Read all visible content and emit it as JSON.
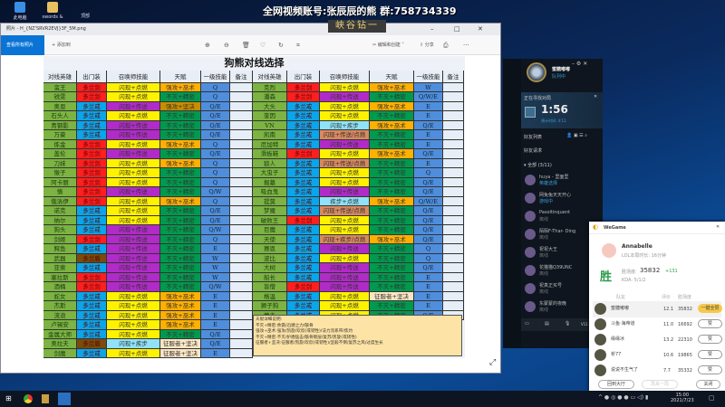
{
  "desktop": {
    "icons": [
      "此电脑",
      "swords &",
      "顶部"
    ]
  },
  "overlay": {
    "banner": "全网视频账号:张辰辰的熊  群:758734339",
    "tag": "峡谷钻一"
  },
  "photos": {
    "title": "照片 - H_{NZ'SRVR2EVJ}3F_5M.png",
    "view_all": "查看所有照片",
    "add_to": "+ 添加到",
    "edit_create": "编辑和创建",
    "share": "分享",
    "sheet": {
      "title": "狗熊对线选择",
      "headers": [
        "对线英雄",
        "出门装",
        "召唤师技能",
        "天赋",
        "一级技能",
        "备注"
      ],
      "colors": {
        "hero": "#7cb342",
        "多兰剑": "#ff1f1f",
        "多兰戒": "#0aa5ea",
        "多兰盾": "#7a4b0a",
        "闪现+点燃": "#fff200",
        "闪现+传送": "#b12bc8",
        "闪现+疾步": "#8fe2f7",
        "疾步+点燃": "#8fe2f7",
        "闪现+传送/点燃": "#d9895e",
        "闪现+疾步/点燃": "#d9895e",
        "强攻+巫术": "#ffb000",
        "不灭+精密": "#009a4e",
        "强攻+坚决": "#c88d00",
        "征服者+坚决": "#fbe6c4",
        "skill": "#4f8edc",
        "note": "#e6eef8"
      },
      "left": [
        [
          "蛮王",
          "多兰剑",
          "闪现+点燃",
          "强攻+巫术",
          "Q"
        ],
        [
          "锐雯",
          "多兰剑",
          "闪现+点燃",
          "不灭+精密",
          "Q"
        ],
        [
          "奥恩",
          "多兰戒",
          "闪现+传送",
          "强攻+坚决",
          "Q/E"
        ],
        [
          "石头人",
          "多兰戒",
          "闪现+点燃",
          "不灭+精密",
          "Q/E"
        ],
        [
          "青钢影",
          "多兰戒",
          "闪现+传送",
          "不灭+精密",
          "Q/E"
        ],
        [
          "万豪",
          "多兰戒",
          "闪现+传送",
          "不灭+精密",
          "Q/E"
        ],
        [
          "炼金",
          "多兰剑",
          "闪现+点燃",
          "强攻+巫术",
          "Q"
        ],
        [
          "盖伦",
          "多兰剑",
          "闪现+传送",
          "不灭+精密",
          "Q/E"
        ],
        [
          "刀妹",
          "多兰剑",
          "闪现+点燃",
          "强攻+巫术",
          "Q"
        ],
        [
          "猴子",
          "多兰剑",
          "闪现+点燃",
          "不灭+精密",
          "Q"
        ],
        [
          "阿卡丽",
          "多兰剑",
          "闪现+点燃",
          "不灭+精密",
          "Q"
        ],
        [
          "慎",
          "多兰剑",
          "闪现+传送",
          "不灭+精密",
          "Q/W"
        ],
        [
          "俄洛伊",
          "多兰剑",
          "闪现+点燃",
          "强攻+巫术",
          "Q"
        ],
        [
          "诺克",
          "多兰戒",
          "闪现+点燃",
          "不灭+精密",
          "Q/E"
        ],
        [
          "纳尔",
          "多兰戒",
          "闪现+点燃",
          "不灭+精密",
          "Q/E"
        ],
        [
          "狗头",
          "多兰戒",
          "闪现+传送",
          "不灭+精密",
          "Q/W"
        ],
        [
          "剑姬",
          "多兰剑",
          "闪现+传送",
          "不灭+精密",
          "Q"
        ],
        [
          "鳄鱼",
          "多兰戒",
          "闪现+传送",
          "不灭+精密",
          "E"
        ],
        [
          "武器",
          "多兰盾",
          "闪现+传送",
          "不灭+精密",
          "W"
        ],
        [
          "亚索",
          "多兰戒",
          "闪现+传送",
          "不灭+精密",
          "W"
        ],
        [
          "塞拉斯",
          "多兰剑",
          "闪现+传送",
          "不灭+精密",
          "W"
        ],
        [
          "酒桶",
          "多兰剑",
          "闪现+传送",
          "不灭+精密",
          "Q/W"
        ],
        [
          "蛇女",
          "多兰戒",
          "闪现+点燃",
          "强攻+巫术",
          "E"
        ],
        [
          "杰斯",
          "多兰戒",
          "闪现+点燃",
          "强攻+巫术",
          "E"
        ],
        [
          "流浪",
          "多兰戒",
          "闪现+点燃",
          "强攻+巫术",
          "E"
        ],
        [
          "卢锡安",
          "多兰戒",
          "闪现+点燃",
          "强攻+巫术",
          "E"
        ],
        [
          "金属大师",
          "多兰戒",
          "闪现+点燃",
          "不灭+精密",
          "Q/E"
        ],
        [
          "奥拉夫",
          "多兰盾",
          "闪现+疾步",
          "征服者+坚决",
          "Q/E"
        ],
        [
          "剑魔",
          "多兰戒",
          "闪现+点燃",
          "征服者+坚决",
          "E"
        ]
      ],
      "right": [
        [
          "克烈",
          "多兰剑",
          "闪现+点燃",
          "强攻+巫术",
          "W"
        ],
        [
          "潘森",
          "多兰剑",
          "闪现+传送",
          "不灭+精密",
          "Q/W/E"
        ],
        [
          "大头",
          "多兰戒",
          "闪现+点燃",
          "强攻+巫术",
          "E"
        ],
        [
          "奎因",
          "多兰戒",
          "闪现+点燃",
          "不灭+精密",
          "E"
        ],
        [
          "VN",
          "多兰戒",
          "闪现+疾步",
          "强攻+巫术",
          "Q/E"
        ],
        [
          "凯南",
          "多兰戒",
          "闪现+传送/点燃",
          "不灭+精密",
          "E"
        ],
        [
          "厄加特",
          "多兰戒",
          "闪现+传送",
          "不灭+精密",
          "E"
        ],
        [
          "滑板鞋",
          "多兰剑",
          "闪现+点燃",
          "强攻+巫术",
          "Q/E"
        ],
        [
          "狼人",
          "多兰戒",
          "闪现+传送/点燃",
          "不灭+精密",
          "E"
        ],
        [
          "大虫子",
          "多兰戒",
          "闪现+点燃",
          "不灭+精密",
          "Q"
        ],
        [
          "掘墓",
          "多兰戒",
          "闪现+点燃",
          "不灭+精密",
          "Q/E"
        ],
        [
          "吸血鬼",
          "多兰戒",
          "闪现+传送",
          "不灭+精密",
          "Q/E"
        ],
        [
          "提莫",
          "多兰戒",
          "疾步+点燃",
          "强攻+巫术",
          "Q/W/E"
        ],
        [
          "梦魇",
          "多兰戒",
          "闪现+传送/点燃",
          "不灭+精密",
          "Q/E"
        ],
        [
          "破败王",
          "多兰剑",
          "闪现+点燃",
          "不灭+精密",
          "Q/E"
        ],
        [
          "巨魔",
          "多兰戒",
          "闪现+点燃",
          "不灭+精密",
          "Q/E"
        ],
        [
          "天使",
          "多兰戒",
          "闪现+疾步/点燃",
          "强攻+巫术",
          "Q/E"
        ],
        [
          "赛恩",
          "多兰戒",
          "闪现+传送",
          "不灭+精密",
          "Q"
        ],
        [
          "波比",
          "多兰戒",
          "闪现+点燃",
          "不灭+精密",
          "Q"
        ],
        [
          "大树",
          "多兰戒",
          "闪现+传送",
          "不灭+精密",
          "Q/E"
        ],
        [
          "船长",
          "多兰戒",
          "闪现+传送",
          "不灭+精密",
          "E"
        ],
        [
          "盲僧",
          "多兰剑",
          "闪现+传送",
          "不灭+精密",
          "E"
        ],
        [
          "格温",
          "多兰戒",
          "闪现+点燃",
          "征服者+坚决",
          "E"
        ],
        [
          "狮子狗",
          "多兰戒",
          "闪现+点燃",
          "不灭+精密",
          "E"
        ],
        [
          "蒙多",
          "多兰戒",
          "闪现+点燃",
          "不灭+精密",
          "Q/E"
        ]
      ],
      "notes": [
        "天赋详细说明:",
        "不灭+精密:余震/迅捷之力/骸骨",
        "强攻+巫术:强攻/凯旋/欢欣(或韧性)/法力流系带/焦灼",
        "不灭+精密:不灭/护盾猛击/骸骨镀层/复苏/凯旋(或韧性)",
        "征服者+坚决:征服者/凯旋/欢欣(或韧性)/坚毅不倒/复苏之风/过度生长"
      ]
    }
  },
  "lol": {
    "level": "4?",
    "status": "队列中",
    "searching": "正在寻找对局",
    "timer": "1:56",
    "estimate": "预计时间: 4:11",
    "friends_title": "好友列表",
    "friend_requests": "好友请求",
    "group": "▾ 全部 (3/11)",
    "friends": [
      {
        "name": "huya - 里面里",
        "status": "英雄选择"
      },
      {
        "name": "网兔兔天天开心",
        "status": "游戏中"
      },
      {
        "name": "Pasoltinquent",
        "status": "离线"
      },
      {
        "name": "陌陌F-Thar- Ding",
        "status": "离线"
      },
      {
        "name": "祝祝大王",
        "status": "离线"
      },
      {
        "name": "花猫猫Q39UNC",
        "status": "离线"
      },
      {
        "name": "祝真正买号",
        "status": "离线"
      },
      {
        "name": "东蒙蒙的夜晚",
        "status": "离线"
      }
    ],
    "version": "V11.15"
  },
  "wegame": {
    "title": "WeGame",
    "user": "Annabelle",
    "playtime": "LOL本局时长: 16分钟",
    "result": "胜",
    "score_label": "胜场度:",
    "score": "35832",
    "delta": "+131",
    "kda": "KDA: 5/1/2",
    "cols": [
      "队友",
      "评价",
      "胜场度"
    ],
    "rows": [
      {
        "name": "蜜糖嘟嘟",
        "rating": "12.1",
        "score": "35832",
        "btn": "一键全赞"
      },
      {
        "name": "斗鱼·海帝道",
        "rating": "11.0",
        "score": "16692",
        "btn": "赞"
      },
      {
        "name": "缘缘冰",
        "rating": "13.2",
        "score": "22310",
        "btn": "赞"
      },
      {
        "name": "祈77",
        "rating": "10.6",
        "score": "19865",
        "btn": "赞"
      },
      {
        "name": "说说不生气了",
        "rating": "7.7",
        "score": "35332",
        "btn": "赞"
      }
    ],
    "footer": [
      "回到大厅",
      "再来一局",
      "关闭"
    ]
  },
  "taskbar": {
    "time": "15:00",
    "date": "2021/7/23"
  }
}
